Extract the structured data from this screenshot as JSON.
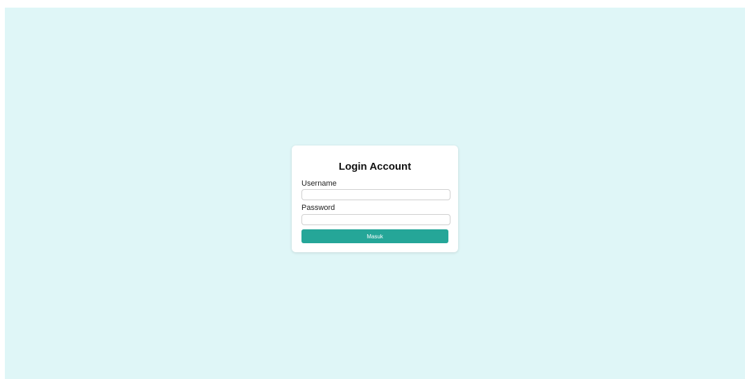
{
  "login_form": {
    "title": "Login Account",
    "username_label": "Username",
    "username_value": "",
    "password_label": "Password",
    "password_value": "",
    "submit_label": "Masuk"
  },
  "colors": {
    "background": "#dff6f7",
    "card": "#ffffff",
    "button": "#25a698",
    "button_text": "#ffffff"
  }
}
